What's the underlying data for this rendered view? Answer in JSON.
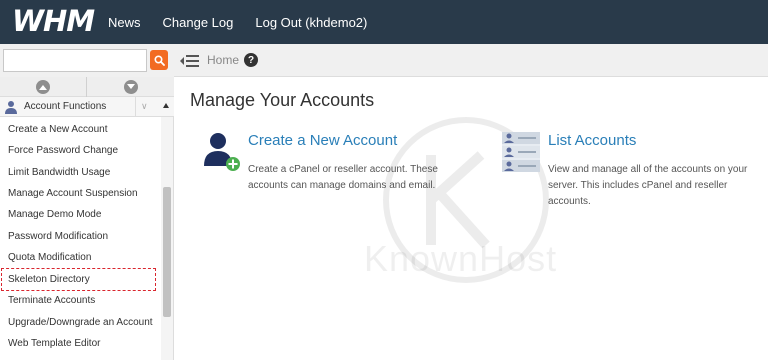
{
  "topbar": {
    "logo": "WHM",
    "nav": [
      "News",
      "Change Log",
      "Log Out (khdemo2)"
    ]
  },
  "breadcrumb": {
    "home": "Home",
    "help": "?"
  },
  "search": {
    "value": "",
    "placeholder": ""
  },
  "sidebar": {
    "section_title": "Account Functions",
    "items": [
      "Create a New Account",
      "Force Password Change",
      "Limit Bandwidth Usage",
      "Manage Account Suspension",
      "Manage Demo Mode",
      "Password Modification",
      "Quota Modification",
      "Skeleton Directory",
      "Terminate Accounts",
      "Upgrade/Downgrade an Account",
      "Web Template Editor"
    ],
    "highlighted_item": "Skeleton Directory"
  },
  "main": {
    "title": "Manage Your Accounts",
    "cards": [
      {
        "title": "Create a New Account",
        "desc_lines": [
          "Create a cPanel or reseller account. These",
          "accounts can manage domains and email."
        ],
        "icon": "user-add-icon"
      },
      {
        "title": "List Accounts",
        "desc_lines": [
          "View and manage all of the accounts on your",
          "server. This includes cPanel and reseller",
          "accounts."
        ],
        "icon": "list-accounts-icon"
      }
    ],
    "watermark": "KnownHost"
  },
  "colors": {
    "topbar": "#293a4a",
    "search_button": "#f26b22",
    "link": "#2a7fb8",
    "highlight": "#d9262e"
  }
}
